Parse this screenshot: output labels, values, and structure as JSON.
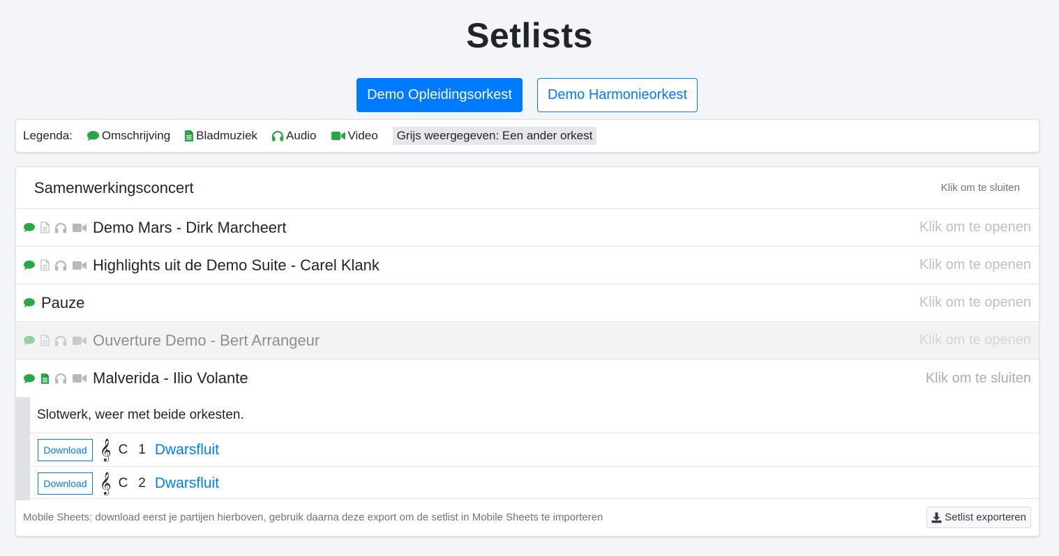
{
  "page_title": "Setlists",
  "orchestras": [
    {
      "label": "Demo Opleidingsorkest"
    },
    {
      "label": "Demo Harmonieorkest"
    }
  ],
  "legend": {
    "label": "Legenda:",
    "description": "Omschrijving",
    "sheet_music": "Bladmuziek",
    "audio": "Audio",
    "video": "Video",
    "grey_note": "Grijs weergegeven: Een ander orkest"
  },
  "colors": {
    "primary": "#007bff",
    "green": "#28a745",
    "icon_grey": "#b5b9bd"
  },
  "setlist": {
    "title": "Samenwerkingsconcert",
    "close_label": "Klik om te sluiten",
    "items": [
      {
        "name": "Demo Mars - Dirk Marcheert",
        "action": "Klik om te openen"
      },
      {
        "name": "Highlights uit de Demo Suite - Carel Klank",
        "action": "Klik om te openen"
      },
      {
        "name": "Pauze",
        "action": "Klik om te openen"
      },
      {
        "name": "Ouverture Demo - Bert Arrangeur",
        "action": "Klik om te openen"
      },
      {
        "name": "Malverida - Ilio Volante",
        "action": "Klik om te sluiten"
      }
    ],
    "expanded": {
      "description": "Slotwerk, weer met beide orkesten.",
      "parts": [
        {
          "download": "Download",
          "clef": "𝄞",
          "key": "C",
          "number": "1",
          "name": "Dwarsfluit"
        },
        {
          "download": "Download",
          "clef": "𝄞",
          "key": "C",
          "number": "2",
          "name": "Dwarsfluit"
        }
      ]
    },
    "footer_note": "Mobile Sheets: download eerst je partijen hierboven, gebruik daarna deze export om de setlist in Mobile Sheets te importeren",
    "export_label": "Setlist exporteren"
  }
}
